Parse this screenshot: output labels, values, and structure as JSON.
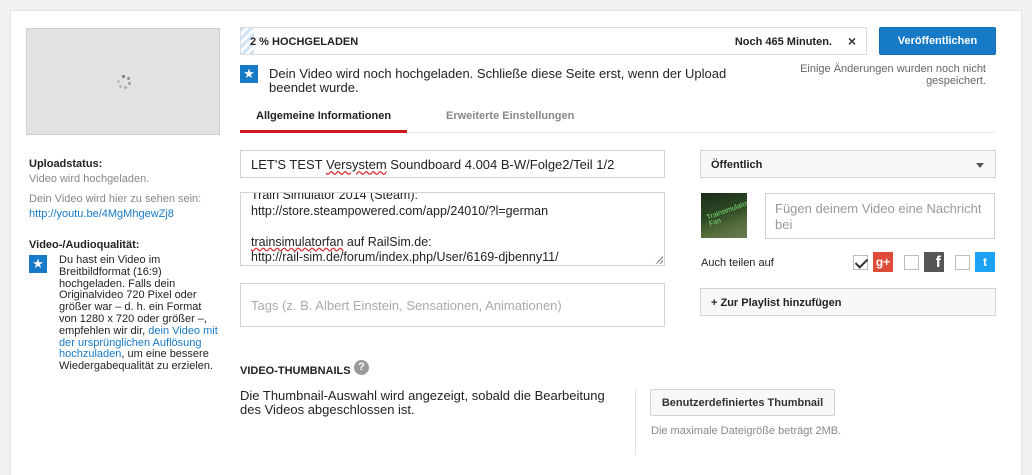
{
  "left": {
    "upload_status_label": "Uploadstatus:",
    "upload_status_value": "Video wird hochgeladen.",
    "video_location_label": "Dein Video wird hier zu sehen sein:",
    "video_url": "http://youtu.be/4MgMhgewZj8",
    "quality_label": "Video-/Audioqualität:",
    "quality_notice_1": "Du hast ein Video im Breitbildformat (16:9) hochgeladen. Falls dein Originalvideo 720 Pixel oder größer war – d. h. ein Format von 1280 x 720 oder größer –, empfehlen wir dir, ",
    "quality_notice_link": "dein Video mit der ursprünglichen Auflösung hochzuladen",
    "quality_notice_2": ", um eine bessere Wiedergabequalität zu erzielen."
  },
  "progress": {
    "percent_label": "2 % HOCHGELADEN",
    "percent": 0.02,
    "eta": "Noch 465 Minuten.",
    "close": "×"
  },
  "publish_button": "Veröffentlichen",
  "unsaved_note": "Einige Änderungen wurden noch nicht gespeichert.",
  "upload_message": "Dein Video wird noch hochgeladen. Schließe diese Seite erst, wenn der Upload beendet wurde.",
  "notice_icon": "★",
  "tabs": [
    {
      "label": "Allgemeine Informationen",
      "active": true
    },
    {
      "label": "Erweiterte Einstellungen",
      "active": false
    }
  ],
  "form": {
    "title_a": "LET'S TEST ",
    "title_squiggle": "Versystem",
    "title_b": " Soundboard 4.004 B-W/Folge2/Teil 1/2",
    "description_line1": "Train Simulator 2014 (Steam):",
    "description_line2": "http://store.steampowered.com/app/24010/?l=german",
    "description_line3": "",
    "description_line4_squiggle": "trainsimulatorfan",
    "description_line4_rest": " auf RailSim.de:",
    "description_line5": "http://rail-sim.de/forum/index.php/User/6169-djbenny11/",
    "tags_placeholder": "Tags (z. B. Albert Einstein, Sensationen, Animationen)"
  },
  "privacy": {
    "selected": "Öffentlich"
  },
  "share": {
    "thumb_text": "Trainsimulator Fan",
    "message_placeholder": "Fügen deinem Video eine Nachricht bei",
    "also_share_label": "Auch teilen auf",
    "networks": [
      {
        "name": "Google+",
        "glyph": "g+",
        "checked": true
      },
      {
        "name": "Facebook",
        "glyph": "f",
        "checked": false
      },
      {
        "name": "Twitter",
        "glyph": "t",
        "checked": false
      }
    ]
  },
  "playlist_button": "+ Zur Playlist hinzufügen",
  "thumbnails": {
    "heading": "VIDEO-THUMBNAILS",
    "help_glyph": "?",
    "message": "Die Thumbnail-Auswahl wird angezeigt, sobald die Bearbeitung des Videos abgeschlossen ist.",
    "custom_button": "Benutzerdefiniertes Thumbnail",
    "max_size": "Die maximale Dateigröße beträgt 2MB."
  }
}
